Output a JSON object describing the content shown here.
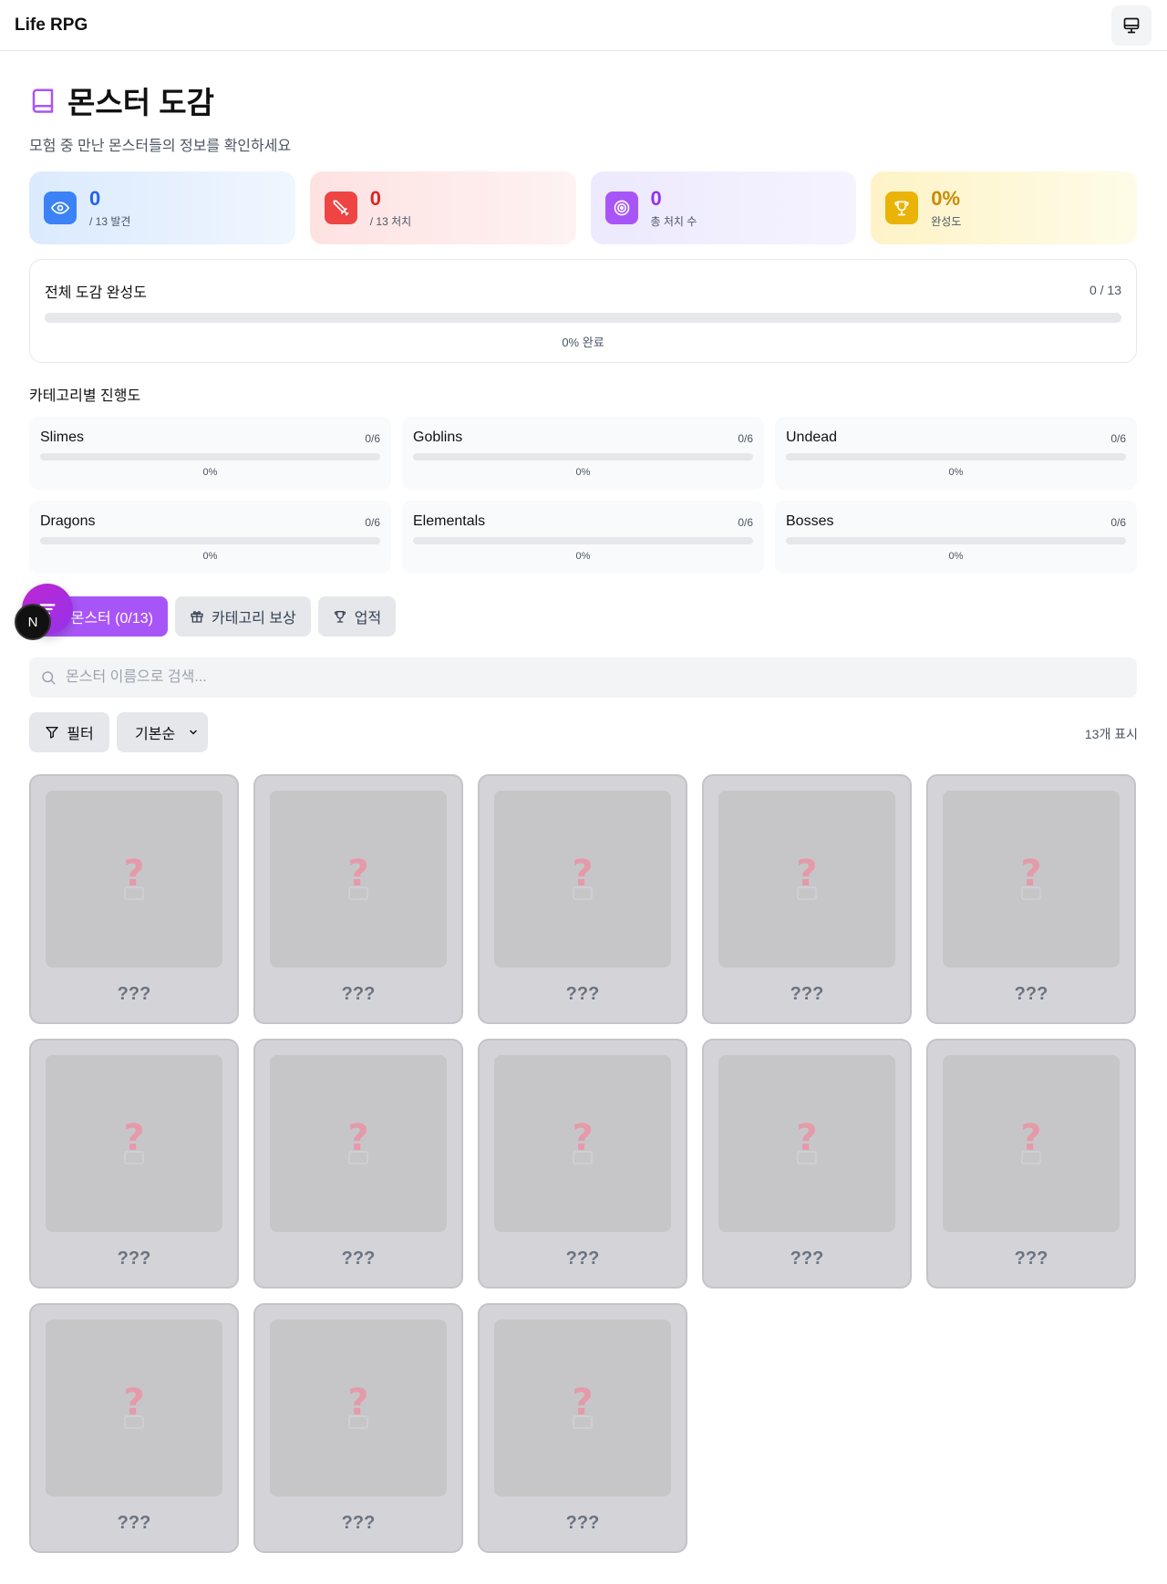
{
  "app": {
    "title": "Life RPG"
  },
  "header": {
    "title": "몬스터 도감",
    "subtitle": "모험 중 만난 몬스터들의 정보를 확인하세요"
  },
  "stats": [
    {
      "value": "0",
      "label": "/ 13 발견",
      "color": "#3b82f6",
      "icon": "eye-icon"
    },
    {
      "value": "0",
      "label": "/ 13 처치",
      "color": "#ef4444",
      "icon": "sword-icon"
    },
    {
      "value": "0",
      "label": "총 처치 수",
      "color": "#a855f7",
      "icon": "target-icon"
    },
    {
      "value": "0%",
      "label": "완성도",
      "color": "#eab308",
      "icon": "trophy-icon"
    }
  ],
  "overall": {
    "title": "전체 도감 완성도",
    "count": "0 / 13",
    "percent_label": "0% 완료",
    "progress": 0
  },
  "categories": {
    "heading": "카테고리별 진행도",
    "items": [
      {
        "name": "Slimes",
        "count": "0/6",
        "percent": "0%",
        "progress": 0
      },
      {
        "name": "Goblins",
        "count": "0/6",
        "percent": "0%",
        "progress": 0
      },
      {
        "name": "Undead",
        "count": "0/6",
        "percent": "0%",
        "progress": 0
      },
      {
        "name": "Dragons",
        "count": "0/6",
        "percent": "0%",
        "progress": 0
      },
      {
        "name": "Elementals",
        "count": "0/6",
        "percent": "0%",
        "progress": 0
      },
      {
        "name": "Bosses",
        "count": "0/6",
        "percent": "0%",
        "progress": 0
      }
    ]
  },
  "tabs": [
    {
      "label": "몬스터 (0/13)",
      "visible_label": "몬스터 (0/13)",
      "active": true
    },
    {
      "label": "카테고리 보상",
      "active": false,
      "icon": "gift-icon"
    },
    {
      "label": "업적",
      "active": false,
      "icon": "trophy-icon"
    }
  ],
  "overlay": {
    "badge": "N"
  },
  "search": {
    "placeholder": "몬스터 이름으로 검색...",
    "value": ""
  },
  "filter": {
    "label": "필터"
  },
  "sort": {
    "selected": "기본순"
  },
  "result_count": "13개 표시",
  "monsters": [
    "???",
    "???",
    "???",
    "???",
    "???",
    "???",
    "???",
    "???",
    "???",
    "???",
    "???",
    "???",
    "???"
  ]
}
